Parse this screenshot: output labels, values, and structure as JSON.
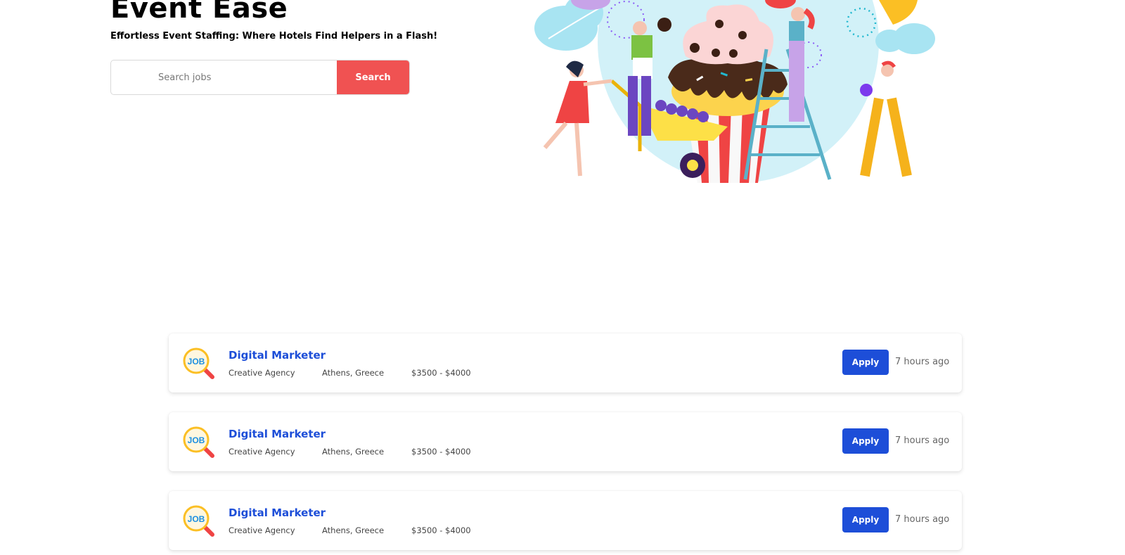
{
  "hero": {
    "title": "Event Ease",
    "subtitle": "Effortless Event Staffing: Where Hotels Find Helpers in a Flash!",
    "search_placeholder": "Search jobs",
    "search_button": "Search"
  },
  "colors": {
    "accent": "#f05252",
    "primary": "#1d4ed8"
  },
  "jobs": [
    {
      "logo": "job-search-icon",
      "title": "Digital Marketer",
      "company": "Creative Agency",
      "location": "Athens, Greece",
      "salary": "$3500 - $4000",
      "apply_label": "Apply",
      "posted": "7 hours ago"
    },
    {
      "logo": "job-search-icon",
      "title": "Digital Marketer",
      "company": "Creative Agency",
      "location": "Athens, Greece",
      "salary": "$3500 - $4000",
      "apply_label": "Apply",
      "posted": "7 hours ago"
    },
    {
      "logo": "job-search-icon",
      "title": "Digital Marketer",
      "company": "Creative Agency",
      "location": "Athens, Greece",
      "salary": "$3500 - $4000",
      "apply_label": "Apply",
      "posted": "7 hours ago"
    }
  ]
}
